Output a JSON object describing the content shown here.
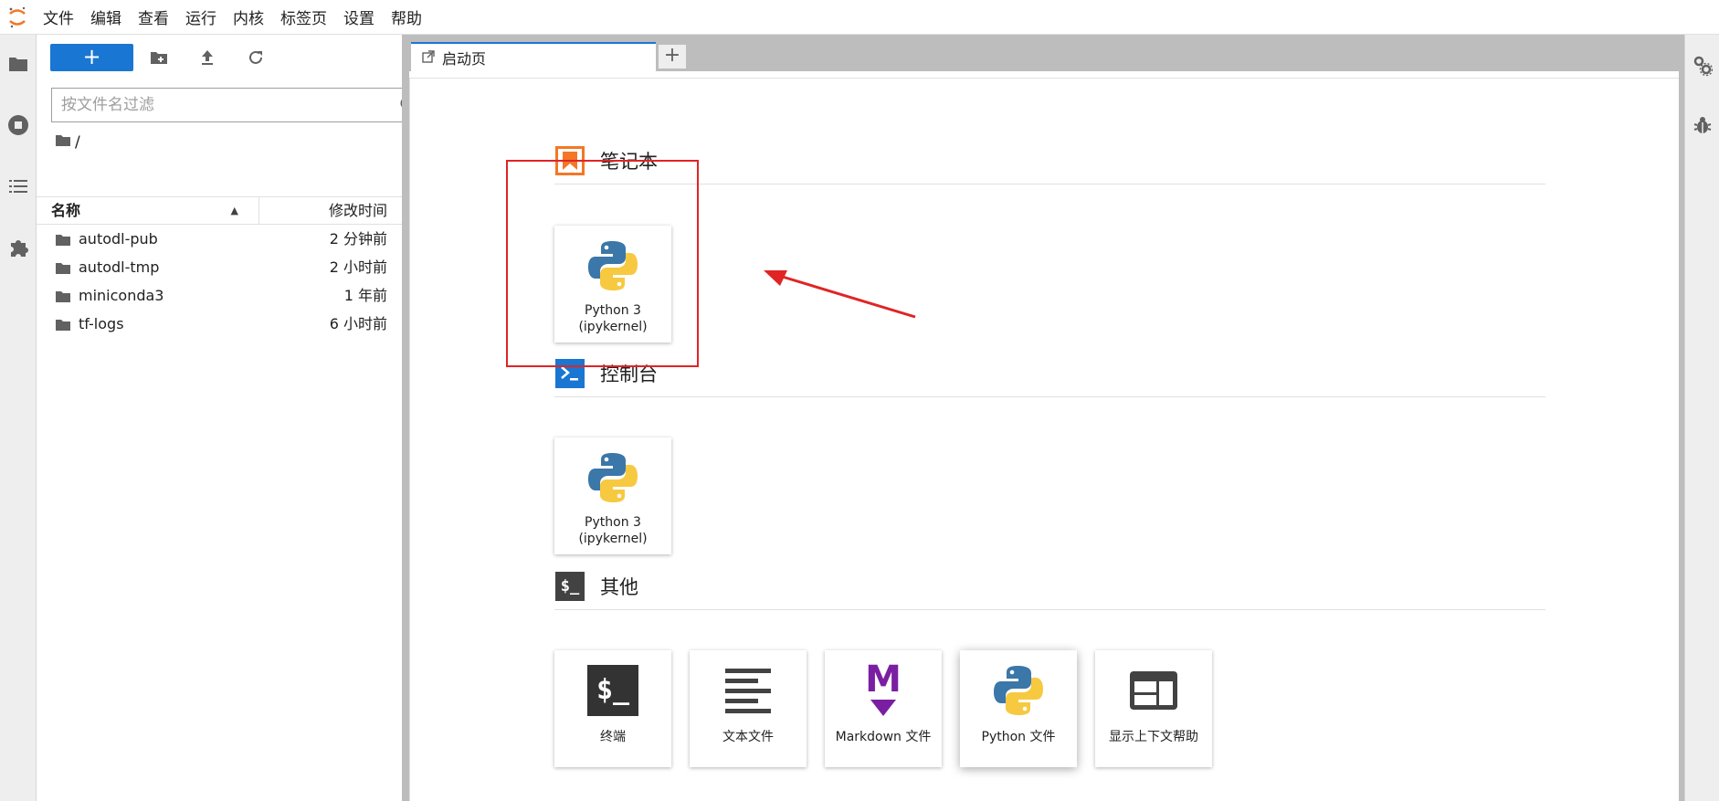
{
  "menubar": {
    "items": [
      "文件",
      "编辑",
      "查看",
      "运行",
      "内核",
      "标签页",
      "设置",
      "帮助"
    ]
  },
  "leftbar": {
    "icons": [
      "folder-icon",
      "running-icon",
      "toc-icon",
      "extension-icon"
    ]
  },
  "filebrowser": {
    "new_label": "+",
    "filter_placeholder": "按文件名过滤",
    "breadcrumb": "/",
    "columns": {
      "name": "名称",
      "modified": "修改时间"
    },
    "files": [
      {
        "name": "autodl-pub",
        "modified": "2 分钟前"
      },
      {
        "name": "autodl-tmp",
        "modified": "2 小时前"
      },
      {
        "name": "miniconda3",
        "modified": "1 年前"
      },
      {
        "name": "tf-logs",
        "modified": "6 小时前"
      }
    ]
  },
  "tabs": {
    "active_label": "启动页",
    "add_label": "+"
  },
  "launcher": {
    "notebook": {
      "title": "笔记本",
      "cards": [
        {
          "label_line1": "Python 3",
          "label_line2": "(ipykernel)"
        }
      ]
    },
    "console": {
      "title": "控制台",
      "cards": [
        {
          "label_line1": "Python 3",
          "label_line2": "(ipykernel)"
        }
      ]
    },
    "other": {
      "title": "其他",
      "icon_text": "$_",
      "cards": [
        {
          "label": "终端",
          "icon": "terminal-icon",
          "glyph": "$_"
        },
        {
          "label": "文本文件",
          "icon": "text-file-icon"
        },
        {
          "label": "Markdown 文件",
          "icon": "markdown-icon",
          "glyph": "M"
        },
        {
          "label": "Python 文件",
          "icon": "python-icon"
        },
        {
          "label": "显示上下文帮助",
          "icon": "context-help-icon"
        }
      ]
    }
  },
  "colors": {
    "accent": "#1976d2",
    "notebook_orange": "#f37726",
    "annotation_red": "#e02424",
    "markdown_purple": "#7b1fa2"
  }
}
